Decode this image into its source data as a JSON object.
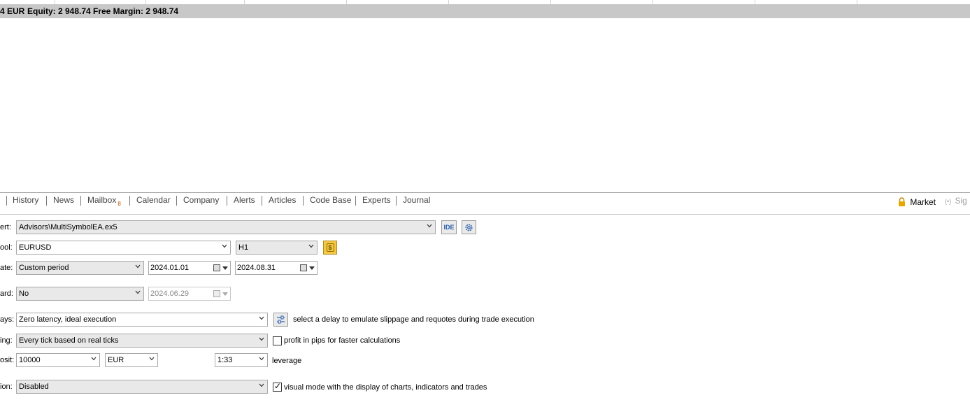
{
  "status": {
    "balance_fragment": "4 EUR",
    "equity": "Equity: 2 948.74",
    "free_margin": "Free Margin: 2 948.74"
  },
  "tabs": [
    {
      "label": "History"
    },
    {
      "label": "News"
    },
    {
      "label": "Mailbox",
      "count": "8"
    },
    {
      "label": "Calendar"
    },
    {
      "label": "Company"
    },
    {
      "label": "Alerts"
    },
    {
      "label": "Articles"
    },
    {
      "label": "Code Base"
    },
    {
      "label": "Experts"
    },
    {
      "label": "Journal"
    }
  ],
  "right_tabs": {
    "market": "Market",
    "signals_fragment": "Sig"
  },
  "form": {
    "expert": {
      "label": "ert:",
      "value": "Advisors\\MultiSymbolEA.ex5",
      "ide_button": "IDE"
    },
    "symbol": {
      "label": "ool:",
      "value": "EURUSD",
      "timeframe": "H1"
    },
    "date": {
      "label": "ate:",
      "value": "Custom period",
      "from": "2024.01.01",
      "to": "2024.08.31"
    },
    "forward": {
      "label": "ard:",
      "value": "No",
      "date": "2024.06.29"
    },
    "delays": {
      "label": "ays:",
      "value": "Zero latency, ideal execution",
      "hint": "select a delay to emulate slippage and requotes during trade execution"
    },
    "modeling": {
      "label": "ing:",
      "value": "Every tick based on real ticks",
      "checkbox_label": "profit in pips for faster calculations",
      "checked": false
    },
    "deposit": {
      "label": "osit:",
      "amount": "10000",
      "currency": "EUR",
      "leverage": "1:33",
      "leverage_label": "leverage"
    },
    "optimization": {
      "label": "ion:",
      "value": "Disabled",
      "checkbox_label": "visual mode with the display of charts, indicators and trades",
      "checked": true
    }
  },
  "colors": {
    "accent": "#2a5ca8",
    "status_bar": "#c8c8c8",
    "lock": "#e6a800"
  }
}
